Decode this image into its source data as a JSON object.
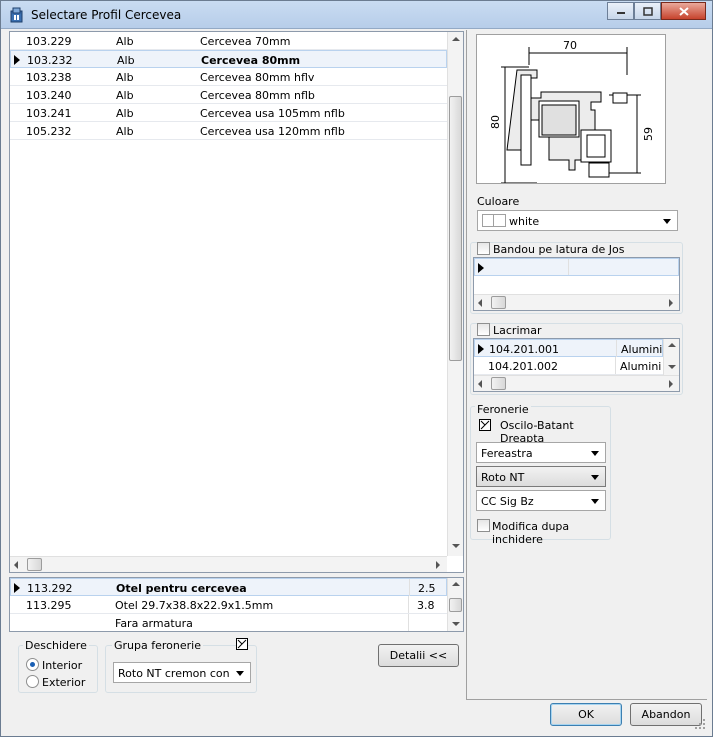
{
  "window": {
    "title": "Selectare Profil Cercevea"
  },
  "profiles": {
    "rows": [
      {
        "code": "103.229",
        "color": "Alb",
        "name": "Cercevea 70mm",
        "selected": false
      },
      {
        "code": "103.232",
        "color": "Alb",
        "name": "Cercevea 80mm",
        "selected": true
      },
      {
        "code": "103.238",
        "color": "Alb",
        "name": "Cercevea 80mm hflv",
        "selected": false
      },
      {
        "code": "103.240",
        "color": "Alb",
        "name": "Cercevea 80mm nflb",
        "selected": false
      },
      {
        "code": "103.241",
        "color": "Alb",
        "name": "Cercevea usa 105mm nflb",
        "selected": false
      },
      {
        "code": "105.232",
        "color": "Alb",
        "name": "Cercevea usa 120mm nflb",
        "selected": false
      }
    ]
  },
  "reinforcement": {
    "rows": [
      {
        "code": "113.292",
        "name": "Otel pentru cercevea",
        "value": "2.5",
        "selected": true
      },
      {
        "code": "113.295",
        "name": "Otel 29.7x38.8x22.9x1.5mm",
        "value": "3.8",
        "selected": false
      },
      {
        "code": "",
        "name": "Fara armatura",
        "value": "",
        "selected": false
      }
    ]
  },
  "deschidere": {
    "label": "Deschidere",
    "options": [
      "Interior",
      "Exterior"
    ],
    "selected": "Interior"
  },
  "grupa_feronerie": {
    "label": "Grupa feronerie",
    "value": "Roto NT cremon constant"
  },
  "details_button": "Detalii <<",
  "drawing": {
    "dim_width": "70",
    "dim_height": "80",
    "dim_inner": "59"
  },
  "culoare": {
    "label": "Culoare",
    "value": "white"
  },
  "bandou": {
    "label": "Bandou pe latura de Jos"
  },
  "lacrimar": {
    "label": "Lacrimar",
    "rows": [
      {
        "code": "104.201.001",
        "name": "Aluminiu p"
      },
      {
        "code": "104.201.002",
        "name": "Aluminiu p"
      }
    ]
  },
  "feronerie": {
    "label": "Feronerie",
    "type": "Oscilo-Batant Dreapta",
    "combo1": "Fereastra",
    "combo2": "Roto NT",
    "combo3": "CC Sig Bz",
    "modify_label": "Modifica dupa inchidere"
  },
  "buttons": {
    "ok": "OK",
    "cancel": "Abandon"
  }
}
